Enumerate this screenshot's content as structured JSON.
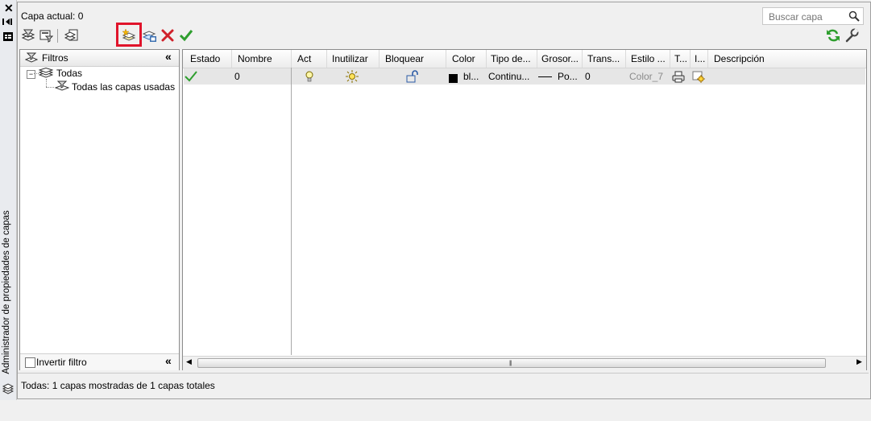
{
  "palette": {
    "title": "Administrador de propiedades de capas"
  },
  "header": {
    "current_layer": "Capa actual: 0",
    "search_placeholder": "Buscar capa"
  },
  "toolbar": {
    "left_icons": [
      "new-property-filter-icon",
      "new-group-filter-icon",
      "layer-states-manager-icon"
    ],
    "layer_icons": [
      "new-layer-icon",
      "new-vp-frozen-layer-icon",
      "delete-layer-icon",
      "set-current-icon"
    ],
    "right_icons": [
      "refresh-icon",
      "settings-icon"
    ]
  },
  "filters": {
    "header_label": "Filtros",
    "tree": [
      {
        "label": "Todas"
      },
      {
        "label": "Todas las capas usadas"
      }
    ],
    "invert_label": "Invertir filtro",
    "invert_checked": false
  },
  "grid": {
    "columns": [
      "Estado",
      "Nombre",
      "Act",
      "Inutilizar",
      "Bloquear",
      "Color",
      "Tipo de...",
      "Grosor...",
      "Trans...",
      "Estilo ...",
      "T...",
      "I...",
      "Descripción"
    ],
    "rows": [
      {
        "estado": "current",
        "nombre": "0",
        "act": "on",
        "inutilizar": "thawed",
        "bloquear": "unlocked",
        "color": "bl...",
        "color_swatch": "#000000",
        "tipo": "Continu...",
        "grosor": "Po...",
        "trans": "0",
        "estilo": "Color_7",
        "descripcion": ""
      }
    ]
  },
  "status_text": "Todas: 1 capas mostradas de 1 capas totales",
  "colors": {
    "highlight": "#e0142b",
    "arrow": "#ff7f27",
    "check": "#2e9e2e"
  }
}
